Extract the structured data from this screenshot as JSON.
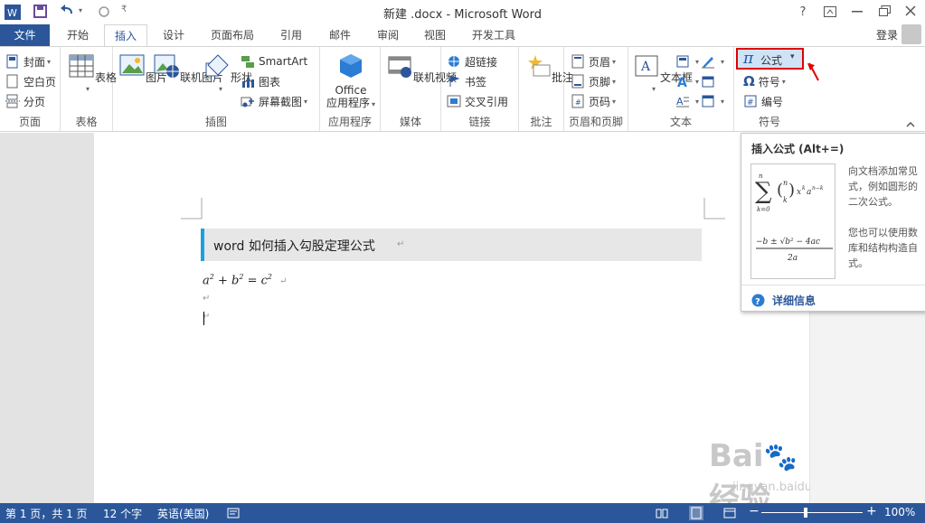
{
  "titlebar": {
    "title": "新建 .docx - Microsoft Word",
    "help": "?"
  },
  "tabs": [
    "文件",
    "开始",
    "插入",
    "设计",
    "页面布局",
    "引用",
    "邮件",
    "审阅",
    "视图",
    "开发工具"
  ],
  "account": {
    "login": "登录"
  },
  "ribbon": {
    "page": {
      "cover": "封面",
      "blank": "空白页",
      "break": "分页",
      "label": "页面"
    },
    "table": {
      "table": "表格",
      "label": "表格"
    },
    "illustrations": {
      "picture": "图片",
      "online_picture": "联机图片",
      "shapes": "形状",
      "smartart": "SmartArt",
      "chart": "图表",
      "screenshot": "屏幕截图",
      "label": "插图"
    },
    "apps": {
      "office_line1": "Office",
      "office_line2": "应用程序",
      "label": "应用程序"
    },
    "media": {
      "online_video": "联机视频",
      "label": "媒体"
    },
    "links": {
      "hyperlink": "超链接",
      "bookmark": "书签",
      "crossref": "交叉引用",
      "label": "链接"
    },
    "comments": {
      "comment": "批注",
      "label": "批注"
    },
    "header_footer": {
      "header": "页眉",
      "footer": "页脚",
      "page_number": "页码",
      "label": "页眉和页脚"
    },
    "text": {
      "textbox": "文本框",
      "label": "文本"
    },
    "symbols": {
      "equation_glyph": "π",
      "equation": "公式",
      "symbol_glyph": "Ω",
      "symbol": "符号",
      "number": "编号",
      "label": "符号"
    }
  },
  "document": {
    "heading": "word  如何插入勾股定理公式"
  },
  "tooltip": {
    "title": "插入公式 (Alt+=)",
    "desc1_l1": "向文档添加常见",
    "desc1_l2": "式，例如圆形的",
    "desc1_l3": "二次公式。",
    "desc2_l1": "您也可以使用数",
    "desc2_l2": "库和结构构造自",
    "desc2_l3": "式。",
    "more": "详细信息"
  },
  "status": {
    "page": "第 1 页，共 1 页",
    "words": "12 个字",
    "lang": "英语(美国)",
    "zoom": "100%"
  },
  "watermark": {
    "line1": "Bai",
    "line2": "经验",
    "url": "jingyan.baidu.com"
  },
  "colors": {
    "accent": "#2b579a",
    "highlight": "#e00000"
  }
}
